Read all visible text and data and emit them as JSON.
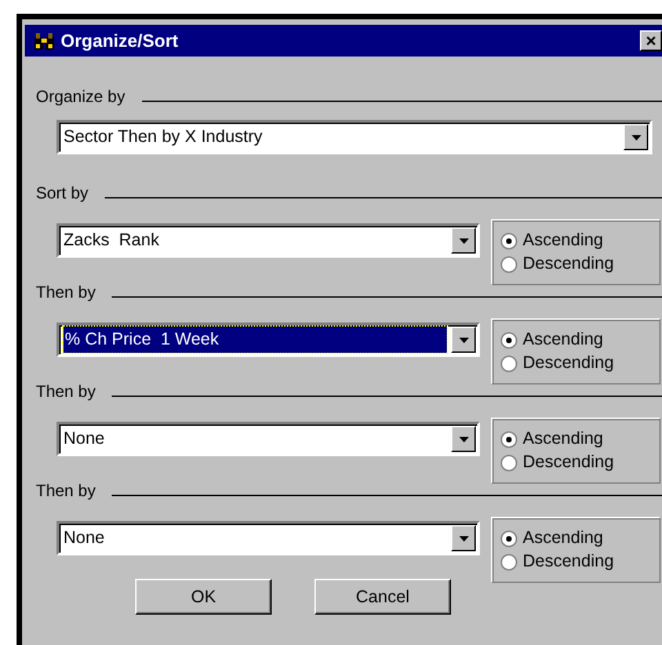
{
  "window": {
    "title": "Organize/Sort",
    "close": "×"
  },
  "organize_by": {
    "label": "Organize by",
    "value": "Sector Then by X Industry"
  },
  "sort_levels": [
    {
      "label": "Sort by",
      "value": "Zacks  Rank",
      "focused": false,
      "orders": [
        {
          "label": "Ascending",
          "selected": true
        },
        {
          "label": "Descending",
          "selected": false
        }
      ]
    },
    {
      "label": "Then by",
      "value": "% Ch Price  1 Week",
      "focused": true,
      "orders": [
        {
          "label": "Ascending",
          "selected": true
        },
        {
          "label": "Descending",
          "selected": false
        }
      ]
    },
    {
      "label": "Then by",
      "value": "None",
      "focused": false,
      "orders": [
        {
          "label": "Ascending",
          "selected": true
        },
        {
          "label": "Descending",
          "selected": false
        }
      ]
    },
    {
      "label": "Then by",
      "value": "None",
      "focused": false,
      "orders": [
        {
          "label": "Ascending",
          "selected": true
        },
        {
          "label": "Descending",
          "selected": false
        }
      ]
    }
  ],
  "buttons": [
    "OK",
    "Cancel"
  ]
}
